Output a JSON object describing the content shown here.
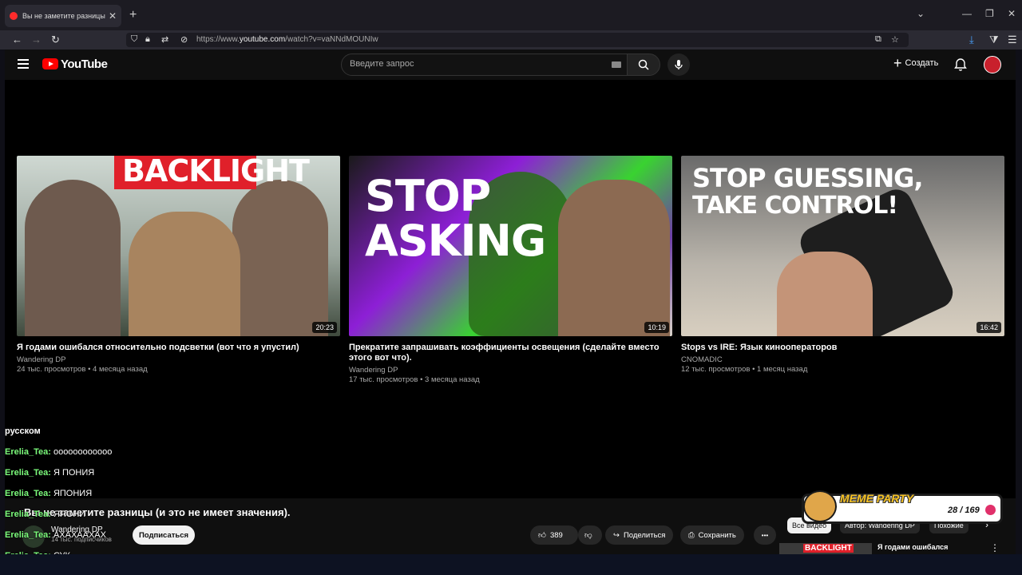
{
  "browser": {
    "tab_title": "Вы не заметите разницы (и это не",
    "tab_close": "✕",
    "new_tab": "+",
    "url_prefix": "https://www.",
    "url_host": "youtube.com",
    "url_path": "/watch?v=vaNNdMOUNIw"
  },
  "youtube": {
    "logo_text": "YouTube",
    "search_placeholder": "Введите запрос",
    "create_label": "Создать",
    "create_plus": "+"
  },
  "videos": [
    {
      "thumb_text": "BACKLIGHT",
      "duration": "20:23",
      "title": "Я годами ошибался относительно подсветки (вот что я упустил)",
      "channel": "Wandering DP",
      "stats": "24 тыс. просмотров • 4 месяца назад"
    },
    {
      "thumb_text_1": "STOP",
      "thumb_text_2": "ASKING",
      "duration": "10:19",
      "title": "Прекратите запрашивать коэффициенты освещения (сделайте вместо этого вот что).",
      "channel": "Wandering DP",
      "stats": "17 тыс. просмотров • 3 месяца назад"
    },
    {
      "thumb_text_1": "STOP GUESSING,",
      "thumb_text_2": "TAKE CONTROL!",
      "duration": "16:42",
      "title": "Stops vs IRE: Язык кинооператоров",
      "channel": "CNOMADIC",
      "stats": "12 тыс. просмотров • 1 месяц назад"
    }
  ],
  "chat": [
    {
      "user": "",
      "text": "русском"
    },
    {
      "user": "Erelia_Tea:",
      "text": "оооооооооооо"
    },
    {
      "user": "Erelia_Tea:",
      "text": "Я ПОНИЯ"
    },
    {
      "user": "Erelia_Tea:",
      "text": "ЯПОНИЯ"
    },
    {
      "user": "Erelia_Tea:",
      "text": "ЯПОНИ"
    },
    {
      "user": "Erelia_Tea:",
      "text": "АХАХААХАХ"
    },
    {
      "user": "Erelia_Tea:",
      "text": "СУК"
    }
  ],
  "player": {
    "title": "Вы не заметите разницы (и это не имеет значения).",
    "channel": "Wandering DP",
    "subscribers": "14 тыс. подписчиков",
    "subscribe_label": "Подписаться",
    "likes": "389",
    "share_label": "Поделиться",
    "save_label": "Сохранить",
    "more": "•••"
  },
  "chips": [
    "Все видео",
    "Автор: Wandering DP",
    "Похожие"
  ],
  "next_video": {
    "thumb_text": "BACKLIGHT",
    "title": "Я годами ошибался"
  },
  "overlay": {
    "brand": "MEME PARTY",
    "count": "28 / 169"
  },
  "colors": {
    "youtube_red": "#ff0000",
    "chat_user": "#7CFC7C",
    "meme_yellow": "#f7c325"
  }
}
